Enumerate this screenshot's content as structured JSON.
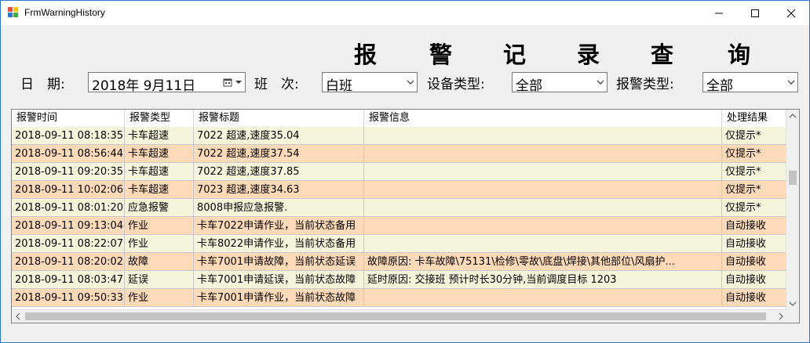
{
  "window": {
    "title": "FrmWarningHistory"
  },
  "heading": {
    "chars": [
      "报",
      "警",
      "记",
      "录",
      "查",
      "询"
    ]
  },
  "filters": {
    "date_label": "日　期:",
    "date_value": "2018年  9月11日",
    "shift_label": "班　次:",
    "shift_value": "白班",
    "device_type_label": "设备类型:",
    "device_type_value": "全部",
    "alarm_type_label": "报警类型:",
    "alarm_type_value": "全部"
  },
  "table": {
    "columns": [
      "报警时间",
      "报警类型",
      "报警标题",
      "报警信息",
      "处理结果"
    ],
    "rows": [
      [
        "2018-09-11 08:18:35",
        "卡车超速",
        "7022 超速,速度35.04",
        "",
        "仅提示*"
      ],
      [
        "2018-09-11 08:56:44",
        "卡车超速",
        "7022 超速,速度37.54",
        "",
        "仅提示*"
      ],
      [
        "2018-09-11 09:20:35",
        "卡车超速",
        "7022 超速,速度37.85",
        "",
        "仅提示*"
      ],
      [
        "2018-09-11 10:02:06",
        "卡车超速",
        "7023 超速,速度34.63",
        "",
        "仅提示*"
      ],
      [
        "2018-09-11 08:01:20",
        "应急报警",
        "8008申报应急报警.",
        "",
        "仅提示*"
      ],
      [
        "2018-09-11 09:13:04",
        "作业",
        "卡车7022申请作业，当前状态备用",
        "",
        "自动接收"
      ],
      [
        "2018-09-11 08:22:07",
        "作业",
        "卡车8022申请作业，当前状态备用",
        "",
        "自动接收"
      ],
      [
        "2018-09-11 08:20:02",
        "故障",
        "卡车7001申请故障，当前状态延误",
        "故障原因: 卡车故障\\75131\\检修\\零故\\底盘\\焊接\\其他部位\\风扇护...",
        "自动接收"
      ],
      [
        "2018-09-11 08:03:47",
        "延误",
        "卡车7001申请延误，当前状态故障",
        "延时原因: 交接班   预计时长30分钟,当前调度目标 1203",
        "自动接收"
      ],
      [
        "2018-09-11 09:50:33",
        "作业",
        "卡车7001申请作业，当前状态故障",
        "",
        "自动接收"
      ]
    ]
  },
  "colors": {
    "row_odd": "#f5f5dc",
    "row_even": "#ffdab9",
    "accent": "#2b78d4"
  }
}
